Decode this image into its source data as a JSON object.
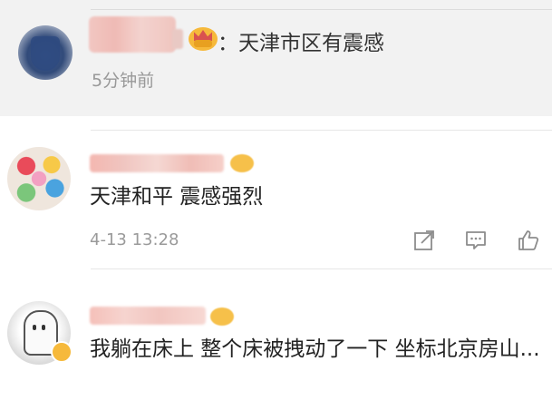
{
  "repost": {
    "text": "：天津市区有震感",
    "time": "5分钟前"
  },
  "comments": [
    {
      "text": "天津和平 震感强烈",
      "time": "4-13 13:28",
      "actions": [
        "share-icon",
        "comment-icon",
        "like-icon"
      ]
    },
    {
      "text": "我躺在床上 整个床被拽动了一下 坐标北京房山..."
    }
  ],
  "colors": {
    "repost_background": "#f2f2f2",
    "primary_text": "#222222",
    "secondary_text": "#999999",
    "vip_badge": "#f6b93b"
  }
}
